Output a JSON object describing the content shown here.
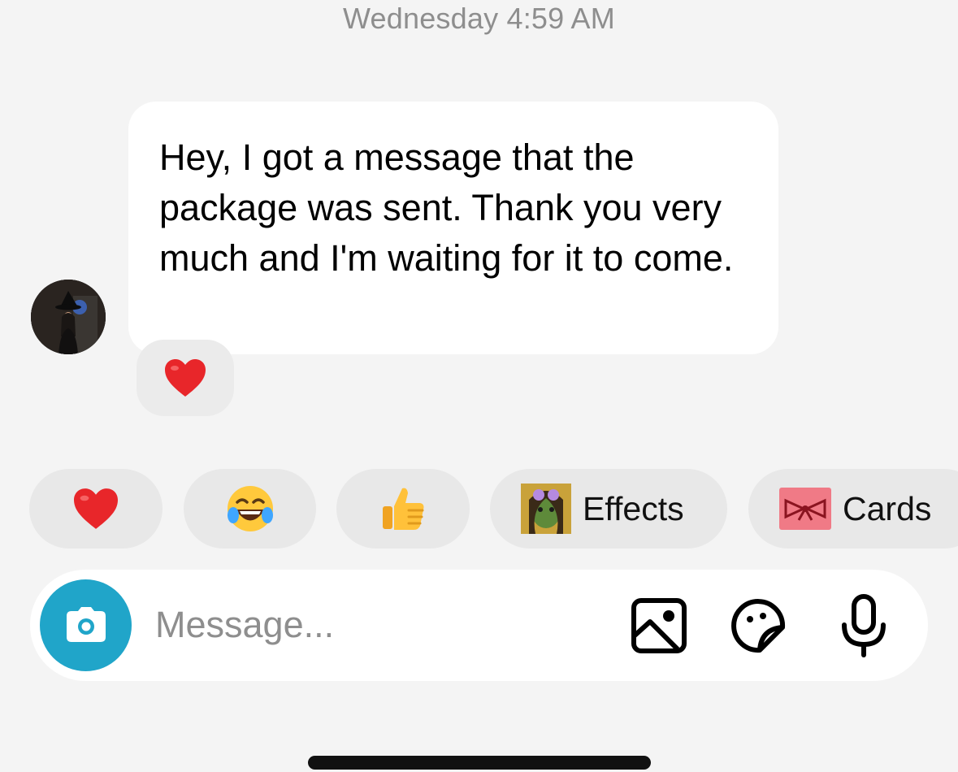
{
  "thread": {
    "timestamp": "Wednesday 4:59 AM",
    "message": {
      "text": "Hey, I got a message that the package was sent. Thank you very much and I'm waiting for it to come.",
      "reaction": "heart-emoji"
    }
  },
  "quick_actions": {
    "items": [
      {
        "name": "heart-emoji",
        "label": ""
      },
      {
        "name": "laughing-emoji",
        "label": ""
      },
      {
        "name": "thumbs-up-emoji",
        "label": ""
      },
      {
        "name": "effects-thumbnail",
        "label": "Effects"
      },
      {
        "name": "cards-thumbnail",
        "label": "Cards"
      }
    ]
  },
  "composer": {
    "placeholder": "Message...",
    "icons": [
      "camera-icon",
      "gallery-icon",
      "sticker-icon",
      "microphone-icon"
    ]
  },
  "colors": {
    "background": "#f4f4f4",
    "bubble": "#ffffff",
    "chip": "#e8e8e8",
    "camera_button": "#20a5c9",
    "muted_text": "#8e8e8e"
  }
}
